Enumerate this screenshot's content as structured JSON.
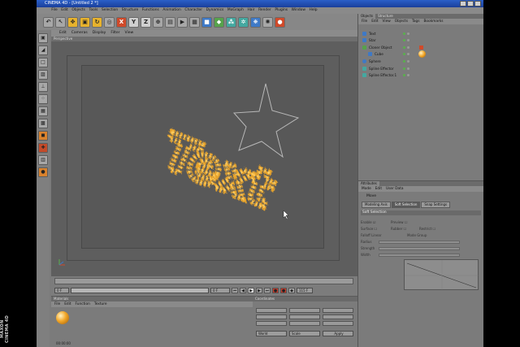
{
  "window": {
    "title": "CINEMA 4D - [Untitled 2 *]"
  },
  "menubar": [
    "File",
    "Edit",
    "Objects",
    "Tools",
    "Selection",
    "Structure",
    "Functions",
    "Animation",
    "Character",
    "Dynamics",
    "MoGraph",
    "Hair",
    "Render",
    "Plugins",
    "Window",
    "Help"
  ],
  "toolbar": {
    "icons": [
      "undo-icon",
      "pointer-icon",
      "move-icon",
      "scale-icon",
      "rotate-icon",
      "x-axis-icon",
      "y-axis-icon",
      "z-axis-icon",
      "coordinate-icon",
      "render-region-icon",
      "render-icon",
      "render-settings-icon",
      "cube-icon",
      "nurbs-icon",
      "cloner-icon",
      "deformer-icon",
      "scene-icon",
      "light-icon",
      "camera-icon"
    ]
  },
  "viewport": {
    "menu": [
      "Edit",
      "Cameras",
      "Display",
      "Filter",
      "View"
    ],
    "label": "Perspective",
    "text_object": "Text"
  },
  "timeline": {
    "start": "0 F",
    "end": "115 F",
    "current": "0 F"
  },
  "materials": {
    "title": "Materials",
    "menu": [
      "File",
      "Edit",
      "Function",
      "Texture"
    ],
    "time": "00:00:00"
  },
  "coordinates": {
    "title": "Coordinates",
    "axes": [
      "X",
      "Y",
      "Z"
    ],
    "world": "World",
    "scale": "Scale",
    "apply": "Apply"
  },
  "objects": {
    "tabs": [
      "Objects",
      "Structure"
    ],
    "menu": [
      "File",
      "Edit",
      "View",
      "Objects",
      "Tags",
      "Bookmarks"
    ],
    "items": [
      {
        "name": "Text",
        "icon_color": "#3e79c6"
      },
      {
        "name": "Star",
        "icon_color": "#3e79c6"
      },
      {
        "name": "Cloner Object",
        "icon_color": "#56a24c"
      },
      {
        "name": "Cube",
        "icon_color": "#3e79c6"
      },
      {
        "name": "Sphere",
        "icon_color": "#3e79c6"
      },
      {
        "name": "Spline Effector",
        "icon_color": "#44a8a0"
      },
      {
        "name": "Spline Effector.1",
        "icon_color": "#44a8a0"
      }
    ]
  },
  "attributes": {
    "title": "Attributes",
    "menu": [
      "Mode",
      "Edit",
      "User Data"
    ],
    "tool": "Move",
    "tabs": [
      "Modeling Axis",
      "Soft Selection",
      "Snap Settings"
    ],
    "section": "Soft Selection",
    "fields": [
      {
        "label": "Enable",
        "value": ""
      },
      {
        "label": "Preview",
        "value": ""
      },
      {
        "label": "Surface",
        "value": ""
      },
      {
        "label": "Rubber",
        "value": ""
      },
      {
        "label": "Restrict",
        "value": ""
      },
      {
        "label": "Falloff",
        "value": "Linear"
      },
      {
        "label": "Mode",
        "value": "Group"
      },
      {
        "label": "Radius",
        "value": ""
      },
      {
        "label": "Strength",
        "value": ""
      },
      {
        "label": "Width",
        "value": ""
      }
    ]
  },
  "brand": {
    "watermark": "MAXON CINEMA 4D"
  },
  "colors": {
    "accent": "#e7a32d",
    "viewport_bg": "#5e5e5e",
    "panel_bg": "#7b7b7b"
  }
}
